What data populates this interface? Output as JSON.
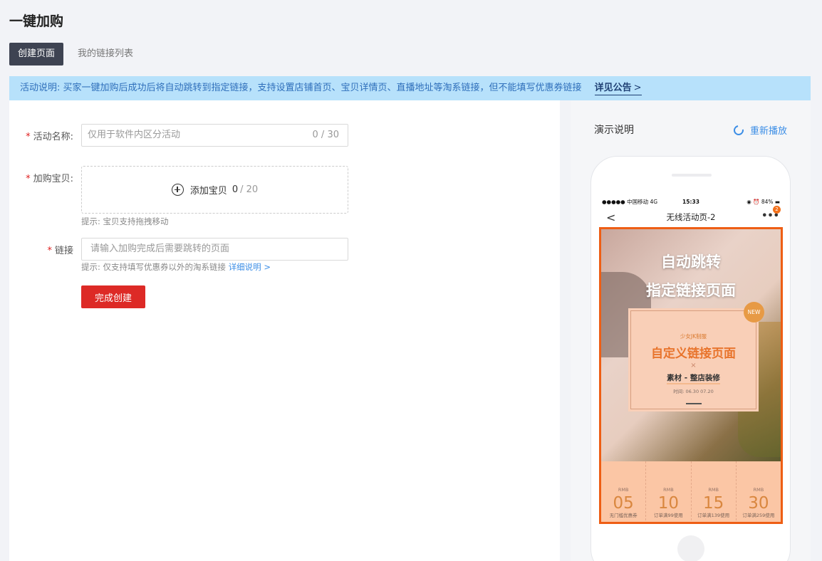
{
  "page": {
    "title": "一键加购"
  },
  "tabs": [
    {
      "label": "创建页面",
      "active": true
    },
    {
      "label": "我的链接列表",
      "active": false
    }
  ],
  "notice": {
    "text": "活动说明: 买家一键加购后成功后将自动跳转到指定链接，支持设置店铺首页、宝贝详情页、直播地址等淘系链接，但不能填写优惠券链接",
    "link_label": "详见公告",
    "link_icon": "chevron-right-icon"
  },
  "form": {
    "activity_name": {
      "label": "活动名称:",
      "placeholder": "仅用于软件内区分活动",
      "counter": "0 / 30"
    },
    "products": {
      "label": "加购宝贝:",
      "button_label": "添加宝贝",
      "count_current": "0",
      "count_max": "/ 20",
      "hint": "提示: 宝贝支持拖拽移动"
    },
    "link": {
      "label": "链接",
      "placeholder": "请输入加购完成后需要跳转的页面",
      "hint": "提示: 仅支持填写优惠券以外的淘系链接",
      "hint_link": "详细说明 >"
    },
    "submit_label": "完成创建",
    "required_mark": "*"
  },
  "demo": {
    "title": "演示说明",
    "replay_label": "重新播放",
    "phone": {
      "status_left": "●●●●● 中国移动  4G",
      "status_time": "15:33",
      "status_right": "◉ ⏰ 84% ▬",
      "nav_title": "无线活动页-2",
      "nav_back": "<",
      "nav_more": "•••",
      "nav_badge": "2",
      "banner_line1": "自动跳转",
      "banner_line2": "指定链接页面",
      "new_badge": "NEW",
      "card_small": "少女JK制服",
      "card_title": "自定义链接页面",
      "card_x": "×",
      "card_sub": "素材 - 整店装修",
      "card_date": "时间: 06.30 07.20",
      "coupons": [
        {
          "rmb": "RMB",
          "amount": "05",
          "desc": "无门槛优惠券"
        },
        {
          "rmb": "RMB",
          "amount": "10",
          "desc": "订单满99使用"
        },
        {
          "rmb": "RMB",
          "amount": "15",
          "desc": "订单满139使用"
        },
        {
          "rmb": "RMB",
          "amount": "30",
          "desc": "订单满259使用"
        }
      ]
    }
  },
  "colors": {
    "primary_red": "#dd2a26",
    "link_blue": "#3c8ee6",
    "notice_bg": "#b7e1fb",
    "banner_orange": "#ee5e14"
  }
}
